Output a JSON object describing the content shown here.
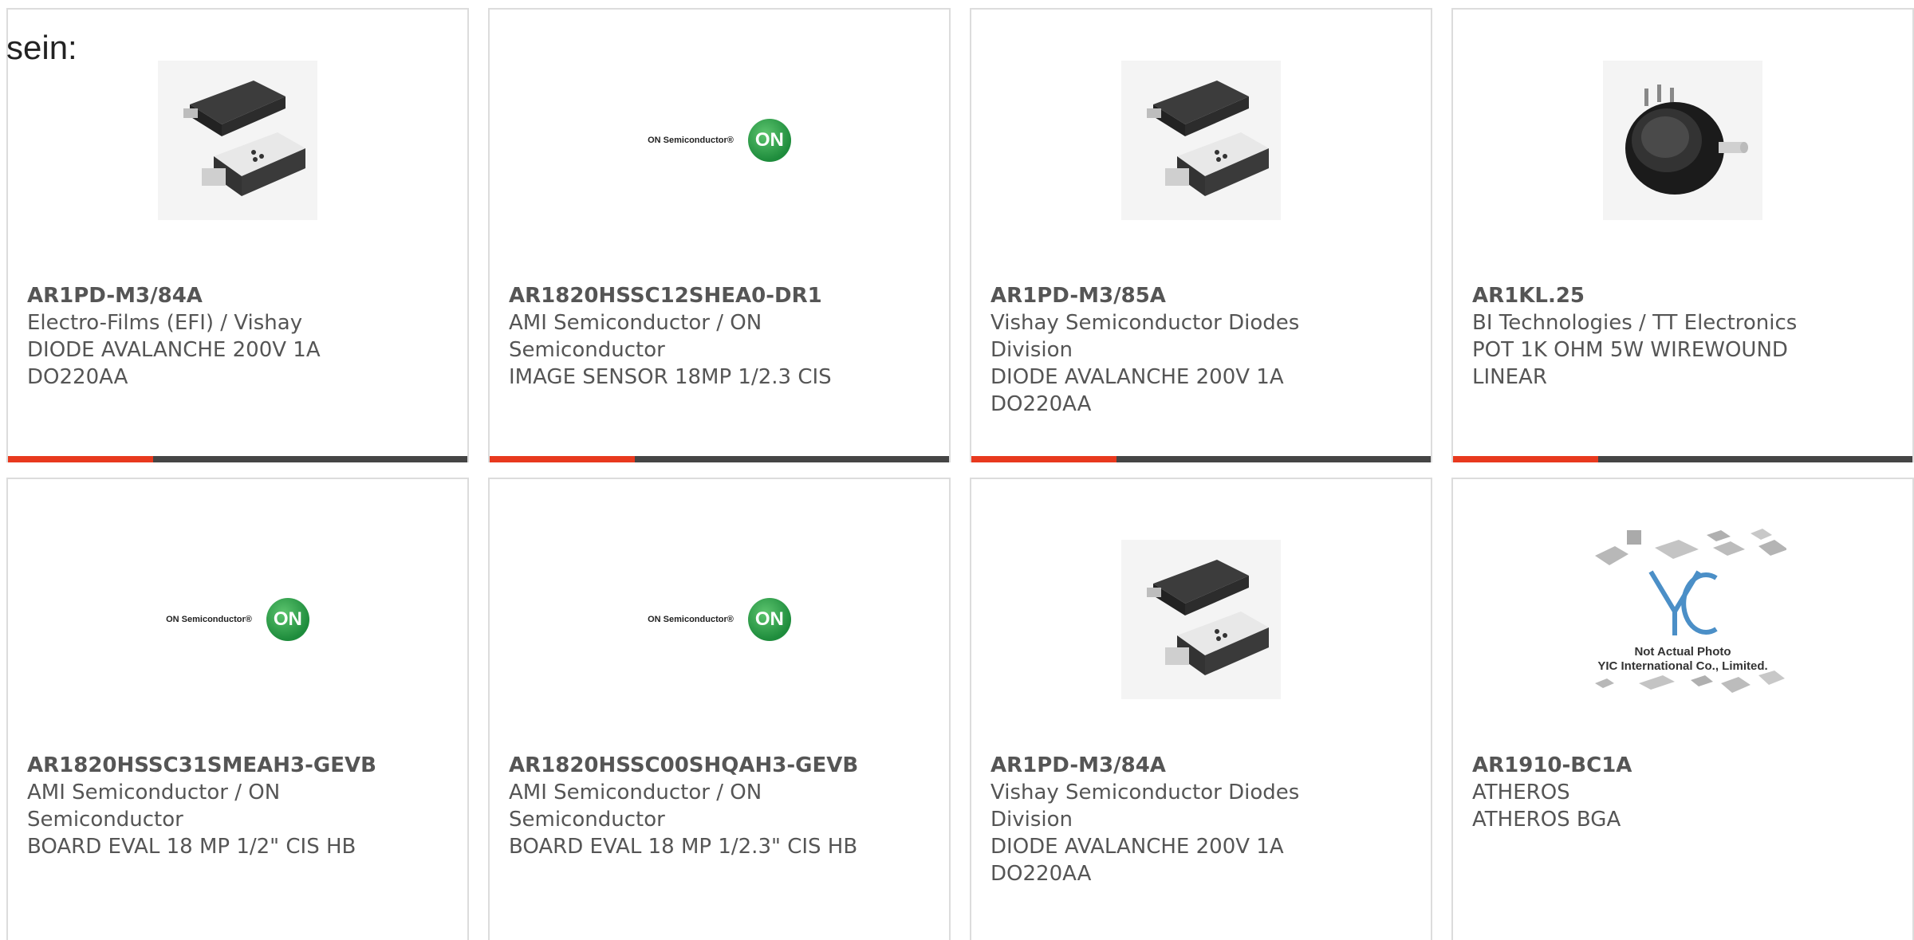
{
  "intro_text": "sein:",
  "colors": {
    "accent": "#e8391e",
    "bar": "#454545",
    "border": "#dcdcdc",
    "on_logo": "#1e8c3c"
  },
  "products": [
    {
      "part": "AR1PD-M3/84A",
      "manufacturer": "Electro-Films (EFI) / Vishay",
      "description": "DIODE AVALANCHE 200V 1A DO220AA",
      "image": "diode-package-image"
    },
    {
      "part": "AR1820HSSC12SHEA0-DR1",
      "manufacturer": "AMI Semiconductor / ON Semiconductor",
      "description": "IMAGE SENSOR 18MP 1/2.3 CIS",
      "image": "on-semiconductor-logo",
      "logo_text": "ON Semiconductor®",
      "logo_badge": "ON"
    },
    {
      "part": "AR1PD-M3/85A",
      "manufacturer": "Vishay Semiconductor Diodes Division",
      "description": "DIODE AVALANCHE 200V 1A DO220AA",
      "image": "diode-package-image"
    },
    {
      "part": "AR1KL.25",
      "manufacturer": "BI Technologies / TT Electronics",
      "description": "POT 1K OHM 5W WIREWOUND LINEAR",
      "image": "potentiometer-image"
    },
    {
      "part": "AR1820HSSC31SMEAH3-GEVB",
      "manufacturer": "AMI Semiconductor / ON Semiconductor",
      "description": "BOARD EVAL 18 MP 1/2\" CIS HB",
      "image": "on-semiconductor-logo",
      "logo_text": "ON Semiconductor®",
      "logo_badge": "ON"
    },
    {
      "part": "AR1820HSSC00SHQAH3-GEVB",
      "manufacturer": "AMI Semiconductor / ON Semiconductor",
      "description": "BOARD EVAL 18 MP 1/2.3\" CIS HB",
      "image": "on-semiconductor-logo",
      "logo_text": "ON Semiconductor®",
      "logo_badge": "ON"
    },
    {
      "part": "AR1PD-M3/84A",
      "manufacturer": "Vishay Semiconductor Diodes Division",
      "description": "DIODE AVALANCHE 200V 1A DO220AA",
      "image": "diode-package-image"
    },
    {
      "part": "AR1910-BC1A",
      "manufacturer": "ATHEROS",
      "description": "ATHEROS BGA",
      "image": "yic-placeholder-image",
      "placeholder_line1": "Not Actual Photo",
      "placeholder_line2": "YIC International Co., Limited."
    }
  ]
}
